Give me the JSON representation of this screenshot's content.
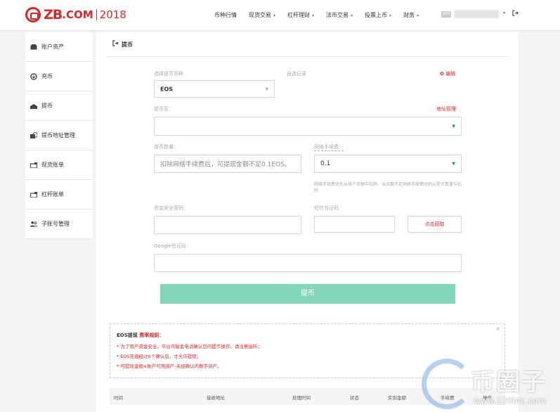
{
  "brand": {
    "logo_text": "ZB",
    "domain_suffix": ".COM",
    "year": "2018",
    "color": "#d8262a"
  },
  "nav": {
    "items": [
      {
        "label": "币种行情",
        "caret": false
      },
      {
        "label": "现货交易",
        "caret": true
      },
      {
        "label": "杠杆理财",
        "caret": true
      },
      {
        "label": "法币交易",
        "caret": true
      },
      {
        "label": "投票上币",
        "caret": true
      },
      {
        "label": "财务",
        "caret": true
      }
    ],
    "vip_badge": "VIP0",
    "user_caret": "▾",
    "logout_icon": "logout-icon"
  },
  "sidebar": {
    "items": [
      {
        "label": "账户资产",
        "icon": "wallet-icon"
      },
      {
        "label": "充币",
        "icon": "deposit-icon"
      },
      {
        "label": "提币",
        "icon": "withdraw-icon"
      },
      {
        "label": "提币地址管理",
        "icon": "address-book-icon"
      },
      {
        "label": "现货账单",
        "icon": "spot-bill-icon"
      },
      {
        "label": "杠杆账单",
        "icon": "leverage-bill-icon"
      },
      {
        "label": "子账号管理",
        "icon": "sub-account-icon"
      }
    ]
  },
  "page": {
    "title": "提币",
    "title_icon": "withdraw-icon"
  },
  "form": {
    "coin_label": "选择提币币种",
    "coin_value": "EOS",
    "custom_record_label": "自选记录",
    "edit_label": "编辑",
    "to_label": "提币至：",
    "address_manage_label": "地址管理",
    "amount_label": "提币数量：",
    "amount_placeholder": "扣除网络手续费后，可提现金额不足0.1EOS。",
    "fee_label": "网络手续费：",
    "fee_value": "0.1",
    "fee_note": "网络手续费优先从账户余额中扣除，当余额不足网络手续费时则从提币数量中扣除",
    "password_label": "资金安全密码：",
    "sms_label": "短信验证码：",
    "sms_button": "点击获取",
    "google_label": "Google验证码：",
    "submit_label": "提币"
  },
  "rules": {
    "title_prefix": "EOS提现",
    "title_highlight": "费率规则：",
    "lines": [
      "* 为了用户资金安全，平台可能会电话确认您的提币操作，请注意接听；",
      "* EOS充值经过6个确认后，才允许提现；",
      "* 可提现金额≤账户可用资产-未经确认的数字资产。"
    ],
    "close": "×"
  },
  "table": {
    "headers": [
      "时间",
      "接收地址",
      "处理时间",
      "状态",
      "实到金额",
      "手续费",
      "操作"
    ]
  },
  "watermark": {
    "text": "币圈子",
    "url": "www.120btc.com"
  }
}
